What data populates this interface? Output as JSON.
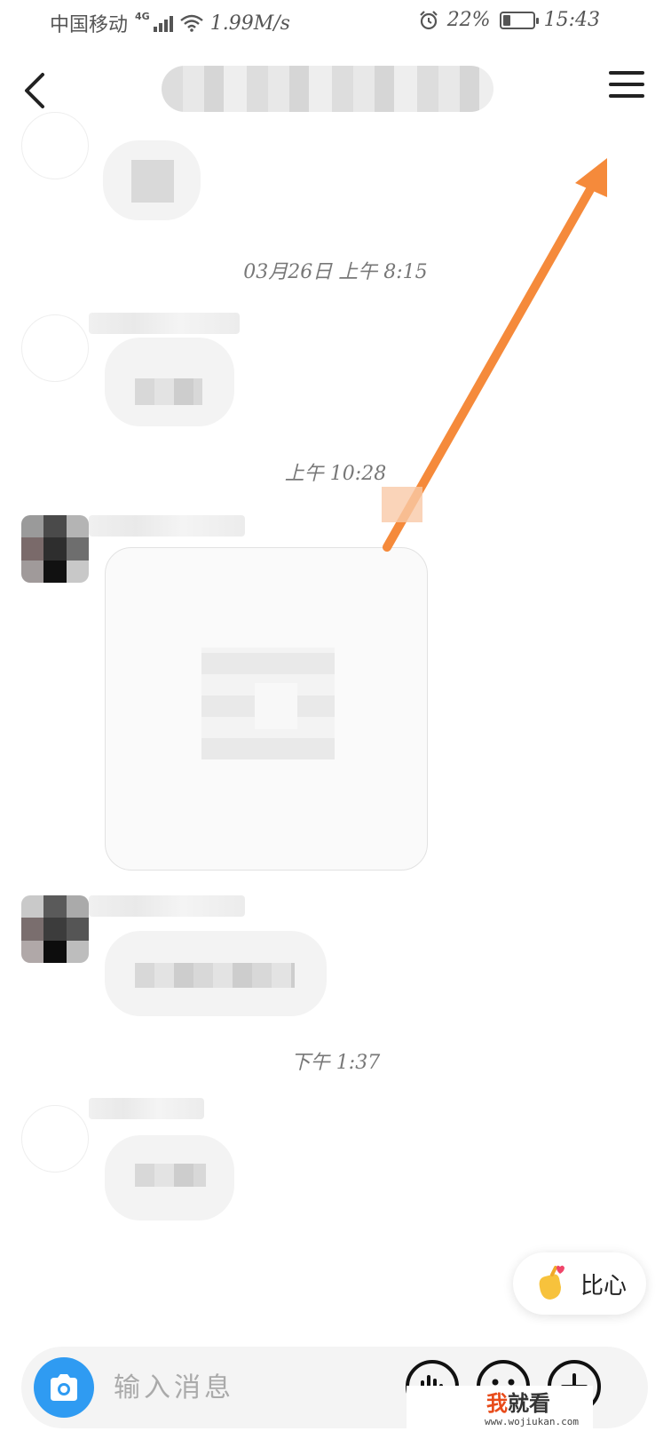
{
  "status_bar": {
    "carrier": "中国移动",
    "network_type": "4G",
    "speed": "1.99M/s",
    "battery": "22%",
    "time": "15:43"
  },
  "header": {
    "back_icon": "chevron-left-icon",
    "menu_icon": "hamburger-menu-icon"
  },
  "timestamps": [
    "03月26日 上午 8:15",
    "上午 10:28",
    "下午 1:37"
  ],
  "heart_button": {
    "label": "比心",
    "icon": "finger-heart-icon"
  },
  "input_bar": {
    "placeholder": "输入消息",
    "camera_icon": "camera-icon",
    "tools": [
      "voice-icon",
      "emoji-icon",
      "plus-icon"
    ]
  },
  "watermark": {
    "brand_highlight": "我",
    "brand_rest": "就看",
    "url": "www.wojiukan.com"
  },
  "colors": {
    "accent": "#2f9bf2",
    "arrow": "#f58a3b",
    "background": "#ffffff"
  }
}
